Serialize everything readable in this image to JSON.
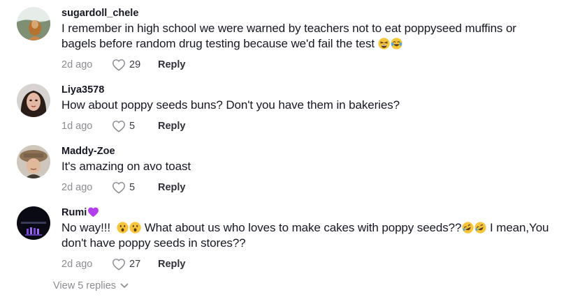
{
  "comments": [
    {
      "username": "sugardoll_chele",
      "text": "I remember in high school we were warned by teachers not to eat poppyseed muffins or bagels before random drug testing because we'd fail the test",
      "emojis": [
        "weary-face-emoji",
        "tears-of-joy-emoji"
      ],
      "time": "2d ago",
      "likes": "29",
      "reply": "Reply"
    },
    {
      "username": "Liya3578",
      "text": "How about poppy seeds buns? Don't you have them in bakeries?",
      "time": "1d ago",
      "likes": "5",
      "reply": "Reply"
    },
    {
      "username": "Maddy-Zoe",
      "text": "It's amazing on avo toast",
      "time": "2d ago",
      "likes": "5",
      "reply": "Reply"
    },
    {
      "username": "Rumi",
      "username_badge": "purple-heart-emoji",
      "text_part1": "No way!!!",
      "text_part2": "What about us who loves to make cakes with poppy seeds??",
      "text_part3": "I mean,You don't have poppy seeds in stores??",
      "time": "2d ago",
      "likes": "27",
      "reply": "Reply"
    }
  ],
  "view_replies": "View 5 replies",
  "colors": {
    "text": "#161823",
    "meta": "#8a8b91",
    "reply": "#2f3038"
  }
}
